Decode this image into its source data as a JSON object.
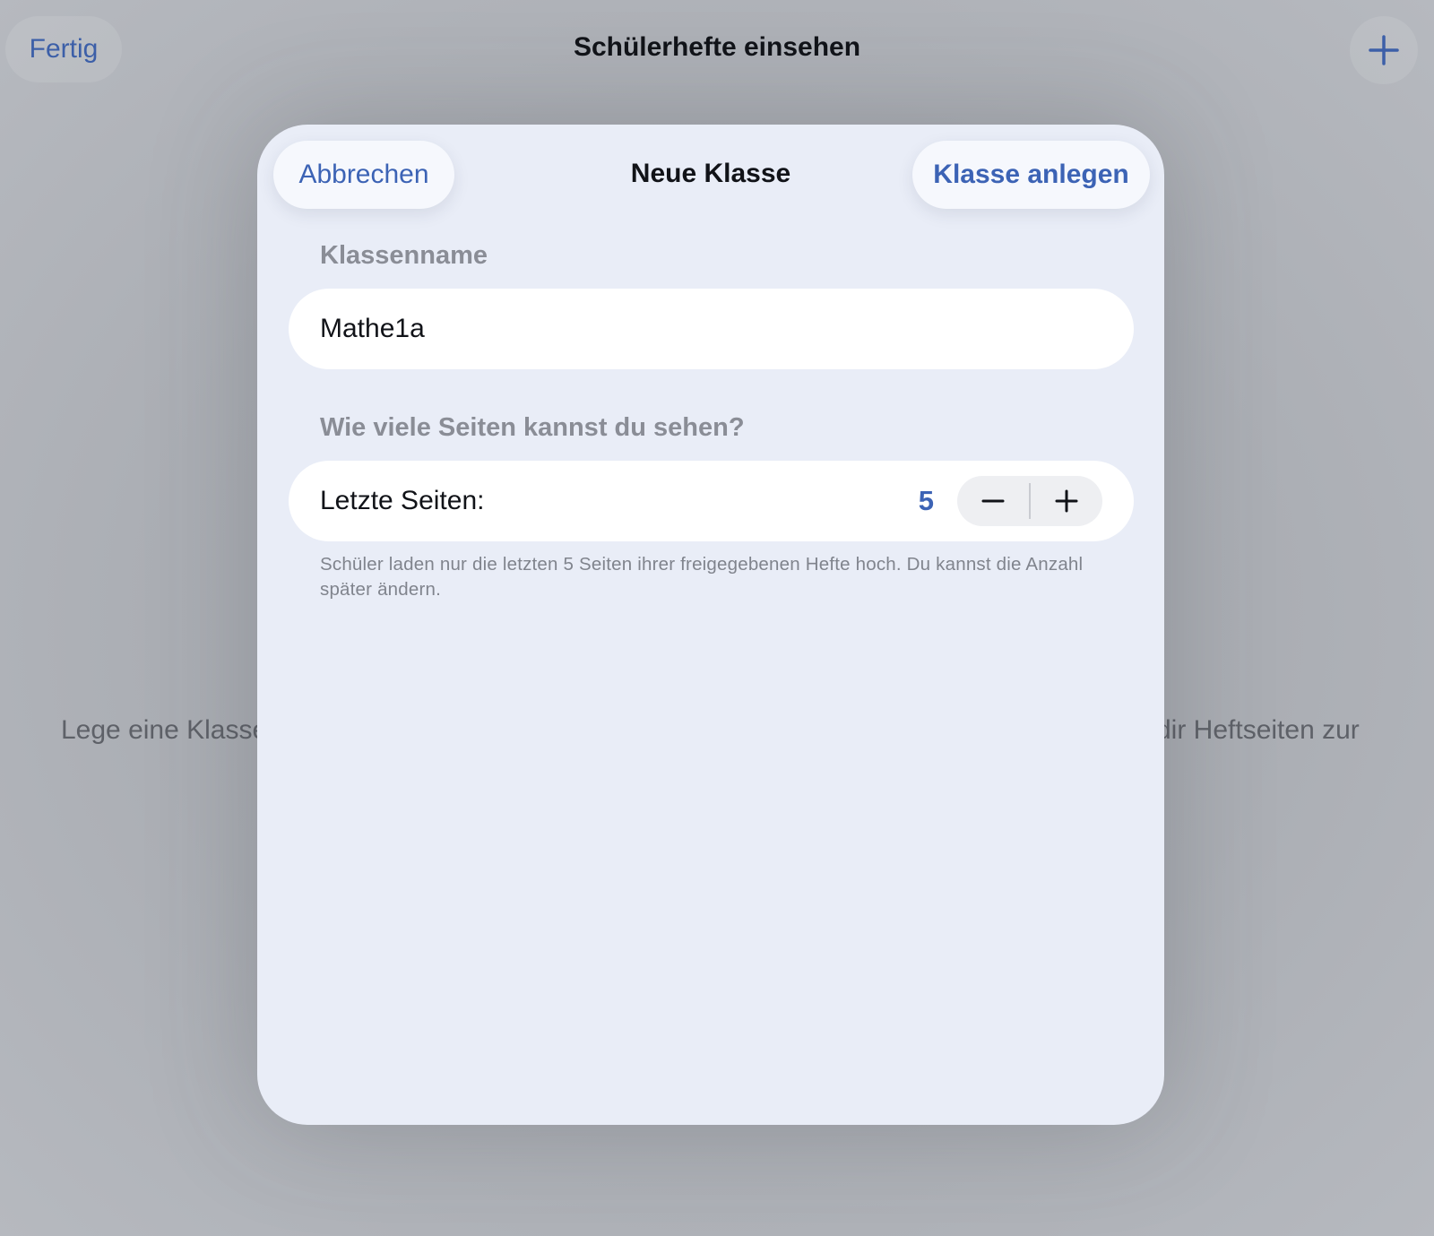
{
  "background": {
    "nav": {
      "done_label": "Fertig",
      "title": "Schülerhefte einsehen",
      "add_icon": "plus-icon"
    },
    "hint_left": "Lege eine Klasse",
    "hint_right": "dir Heftseiten zur"
  },
  "sheet": {
    "title": "Neue Klasse",
    "cancel_label": "Abbrechen",
    "create_label": "Klasse anlegen",
    "class_name": {
      "section_label": "Klassenname",
      "value": "Mathe1a"
    },
    "pages": {
      "section_label": "Wie viele Seiten kannst du sehen?",
      "row_label": "Letzte Seiten:",
      "value": "5",
      "decrement_icon": "minus-icon",
      "increment_icon": "plus-icon",
      "footnote": "Schüler laden nur die letzten 5 Seiten ihrer freigegebenen Hefte hoch. Du kannst die Anzahl später ändern."
    }
  },
  "colors": {
    "accent": "#3c63b5",
    "sheet_background": "#e9edf7",
    "dimmed_background": "#aeb1b7"
  }
}
